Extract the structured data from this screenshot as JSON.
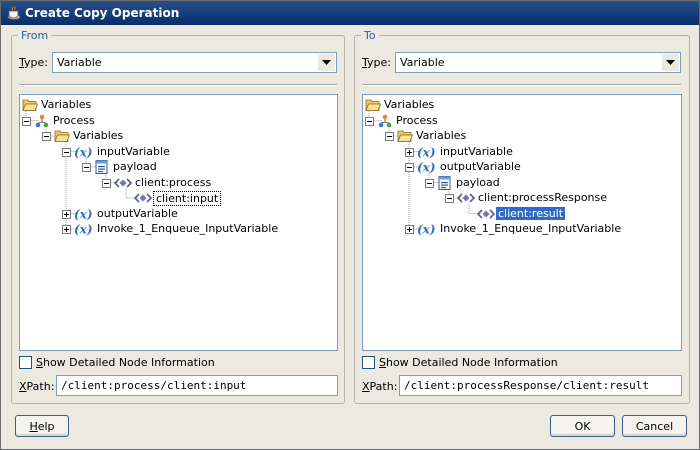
{
  "window": {
    "title": "Create Copy Operation"
  },
  "from": {
    "legend": "From",
    "type_label_main": "ype:",
    "type_label_mnemonic": "T",
    "type_value": "Variable",
    "tree": [
      {
        "label": "Variables",
        "icon": "folder-open-icon",
        "exp": null
      },
      {
        "label": "Process",
        "icon": "process-icon",
        "exp": "minus"
      },
      {
        "label": "Variables",
        "icon": "folder-open-icon",
        "exp": "minus"
      },
      {
        "label": "inputVariable",
        "icon": "variable-icon",
        "exp": "minus"
      },
      {
        "label": "payload",
        "icon": "message-part-icon",
        "exp": "minus"
      },
      {
        "label": "client:process",
        "icon": "element-icon",
        "exp": "minus"
      },
      {
        "label": "client:input",
        "icon": "element-icon",
        "exp": null
      },
      {
        "label": "outputVariable",
        "icon": "variable-icon",
        "exp": "plus"
      },
      {
        "label": "Invoke_1_Enqueue_InputVariable",
        "icon": "variable-icon",
        "exp": "plus"
      }
    ],
    "show_detail_mnemonic": "S",
    "show_detail_rest": "how Detailed Node Information",
    "xpath_mnemonic": "X",
    "xpath_rest": "Path:",
    "xpath_value": "/client:process/client:input"
  },
  "to": {
    "legend": "To",
    "type_label_main": "ype:",
    "type_label_mnemonic": "T",
    "type_value": "Variable",
    "tree": [
      {
        "label": "Variables",
        "icon": "folder-open-icon",
        "exp": null
      },
      {
        "label": "Process",
        "icon": "process-icon",
        "exp": "minus"
      },
      {
        "label": "Variables",
        "icon": "folder-open-icon",
        "exp": "minus"
      },
      {
        "label": "inputVariable",
        "icon": "variable-icon",
        "exp": "plus"
      },
      {
        "label": "outputVariable",
        "icon": "variable-icon",
        "exp": "minus"
      },
      {
        "label": "payload",
        "icon": "message-part-icon",
        "exp": "minus"
      },
      {
        "label": "client:processResponse",
        "icon": "element-icon",
        "exp": "minus"
      },
      {
        "label": "client:result",
        "icon": "element-icon",
        "exp": null
      },
      {
        "label": "Invoke_1_Enqueue_InputVariable",
        "icon": "variable-icon",
        "exp": "plus"
      }
    ],
    "show_detail_mnemonic": "S",
    "show_detail_rest": "how Detailed Node Information",
    "xpath_mnemonic": "X",
    "xpath_rest": "Path:",
    "xpath_value": "/client:processResponse/client:result"
  },
  "buttons": {
    "help_mnemonic": "H",
    "help_rest": "elp",
    "ok": "OK",
    "cancel": "Cancel"
  }
}
